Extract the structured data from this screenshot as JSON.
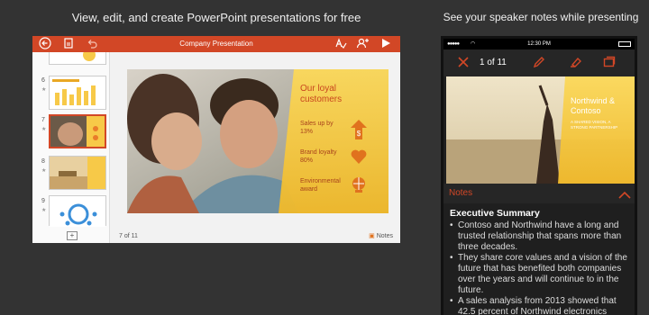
{
  "captions": {
    "left": "View, edit, and create PowerPoint presentations for free",
    "right": "See your speaker notes while presenting"
  },
  "tablet": {
    "title": "Company Presentation",
    "slide_numbers": [
      "6",
      "7",
      "8",
      "9"
    ],
    "slide_info": "7 of 11",
    "notes_label": "Notes",
    "slide": {
      "heading": "Our loyal customers",
      "items": [
        {
          "text": "Sales up by 13%",
          "icon": "dollar-icon"
        },
        {
          "text": "Brand loyalty 80%",
          "icon": "heart-icon"
        },
        {
          "text": "Environmental award",
          "icon": "globe-icon"
        }
      ]
    }
  },
  "phone": {
    "time": "12:30 PM",
    "counter": "1 of 11",
    "slide": {
      "title": "Northwind & Contoso",
      "subtitle": "A SHARED VISION, A STRONG PARTNERSHIP"
    },
    "notes_label": "Notes",
    "notes_heading": "Executive Summary",
    "notes_bullets": [
      "Contoso and Northwind have a long and trusted relationship that spans more than three decades.",
      "They share core values and a vision of the future that has benefited both companies over the years and will continue to in the future.",
      "A sales analysis from 2013 showed that 42.5 percent of Northwind electronics"
    ]
  },
  "colors": {
    "accent": "#d24726",
    "slide_gold": "#f7c948",
    "background": "#333333"
  }
}
